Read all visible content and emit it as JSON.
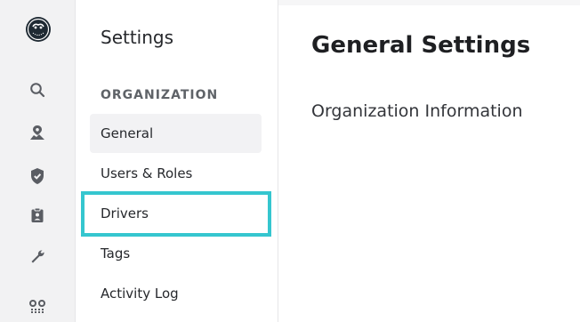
{
  "nav": {
    "logo_icon": "owl-logo-icon",
    "icons": [
      "search-icon",
      "map-pin-icon",
      "shield-check-icon",
      "clipboard-user-icon",
      "wrench-icon",
      "route-icon"
    ]
  },
  "settings_menu": {
    "title": "Settings",
    "section_label": "ORGANIZATION",
    "items": [
      {
        "label": "General",
        "active": true
      },
      {
        "label": "Users & Roles",
        "active": false
      },
      {
        "label": "Drivers",
        "active": false,
        "highlighted": true
      },
      {
        "label": "Tags",
        "active": false
      },
      {
        "label": "Activity Log",
        "active": false
      }
    ]
  },
  "main": {
    "title": "General Settings",
    "subtitle": "Organization Information"
  },
  "colors": {
    "highlight": "#35c6cf",
    "rail_background": "#f2f2f3",
    "active_item_background": "#f2f2f4"
  }
}
